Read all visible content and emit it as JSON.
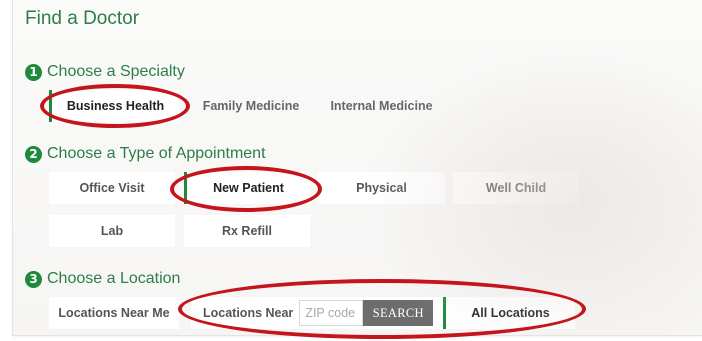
{
  "title": "Find a Doctor",
  "sections": [
    {
      "number": "1",
      "label": "Choose a Specialty"
    },
    {
      "number": "2",
      "label": "Choose a Type of Appointment"
    },
    {
      "number": "3",
      "label": "Choose a Location"
    }
  ],
  "specialties": [
    "Business Health",
    "Family Medicine",
    "Internal Medicine"
  ],
  "appointments": [
    "Office Visit",
    "New Patient",
    "Physical",
    "Well Child",
    "Lab",
    "Rx Refill"
  ],
  "locations": {
    "near_me": "Locations Near Me",
    "near_label": "Locations Near",
    "zip_placeholder": "ZIP code",
    "search_label": "SEARCH",
    "all": "All Locations"
  },
  "selected": {
    "specialty": "Business Health",
    "appointment": "New Patient",
    "location": "All Locations"
  },
  "colors": {
    "accent_green": "#1e8a3e",
    "title_green": "#2e7d4a",
    "annotation_red": "#c4141c",
    "search_button": "#6d6d6d"
  }
}
